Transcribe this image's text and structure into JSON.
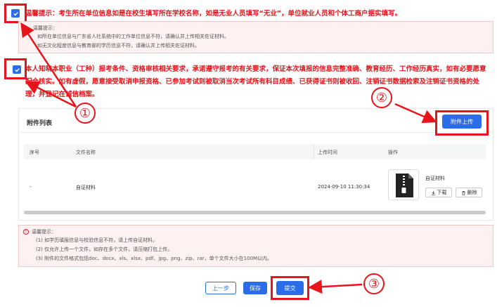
{
  "notice1": {
    "text": "温馨提示：考生所在单位信息如是在校生填写所在学校名称，如是无业人员填写“无业”，单位就业人员和个体工商户据实填写。",
    "tip_title": "温馨提示：",
    "tip_lines": [
      "如所在单位信息与广东省人社系统中的工作单位信息不符，请确认并上传相关佐证材料。",
      "如无文化程度信息与教育部的学历信息不符，请确认并上传相关佐证材料。"
    ]
  },
  "notice2": {
    "text": "本人知晓本职业（工种）报考条件、资格审核相关要求，承诺遵守报考的有关要求，保证本次填报的信息完整准确、教育经历、工作经历真实，如有必要愿意配合核实。如有虚假，愿意接受取消申报资格、已参加考试则被取消当次考试所有科目成绩、已获得证书则被收回、注销证书数据检索及注销证书资格的处理，并登记在诚信档案。"
  },
  "attachments": {
    "title": "附件列表",
    "upload_label": "附件上传",
    "columns": [
      "序号",
      "文件名称",
      "上传时间",
      "操作"
    ],
    "rows": [
      {
        "index": "-",
        "name": "自证材料",
        "time": "2024-09-10 11:30:34",
        "file_label": "自证材料",
        "download_label": "下载",
        "delete_label": "删除"
      }
    ]
  },
  "tips": {
    "title": "温馨提示：",
    "lines": [
      "(1) 如学历填报信息与校验信息不符，请上传自证材料。",
      "(2) 仅允许上传一个文件，如存在多个文件，请压缩打包上传。",
      "(3) 附件的文件格式包括doc、docx、xls、xlsx、pdf、jpg、png、zip、rar，单个文件大小在100M以内。"
    ]
  },
  "footer": {
    "prev_label": "上一步",
    "save_label": "保存",
    "submit_label": "提交"
  },
  "annotations": {
    "n1": "①",
    "n2": "②",
    "n3": "③"
  },
  "colors": {
    "accent": "#2b6de8",
    "alert": "#e8141b"
  }
}
